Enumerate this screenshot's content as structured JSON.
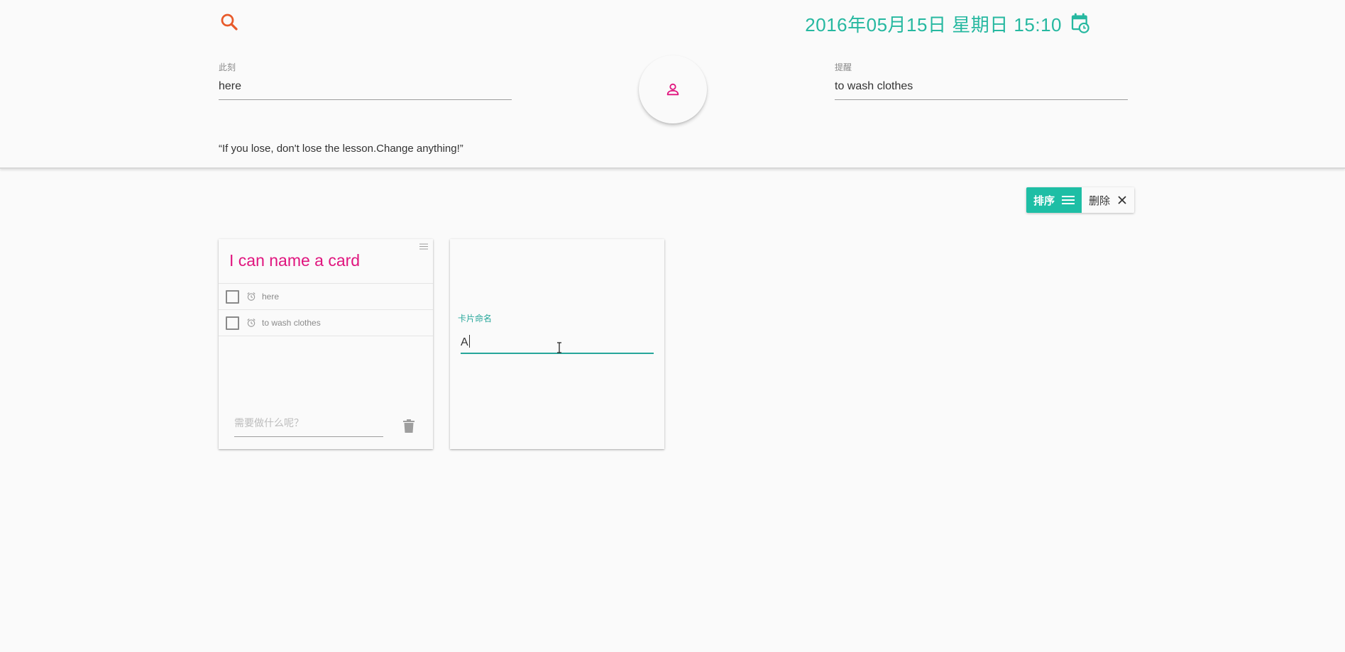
{
  "header": {
    "datetime": "2016年05月15日 星期日 15:10",
    "now_field": {
      "label": "此刻",
      "value": "here"
    },
    "remind_field": {
      "label": "提醒",
      "value": "to wash clothes"
    },
    "quote": "“If you lose, don't lose the lesson.Change anything!”"
  },
  "toolbar": {
    "sort_label": "排序",
    "delete_label": "删除"
  },
  "cards": [
    {
      "title": "I can name a card",
      "todos": [
        {
          "text": "here",
          "checked": false
        },
        {
          "text": "to wash clothes",
          "checked": false
        }
      ],
      "new_todo_placeholder": "需要做什么呢？"
    },
    {
      "name_label": "卡片命名",
      "name_value": "A"
    }
  ],
  "colors": {
    "accent_teal": "#1ebea5",
    "title_pink": "#e0157e",
    "search_orange": "#e85a2a",
    "background": "#fafafa"
  },
  "icons": {
    "search": "search-icon",
    "calendar": "calendar-clock-icon",
    "avatar": "person-icon",
    "sort": "menu-lines-icon",
    "delete": "close-icon",
    "drag": "drag-handle-icon",
    "alarm": "alarm-icon",
    "trash": "trash-icon"
  }
}
